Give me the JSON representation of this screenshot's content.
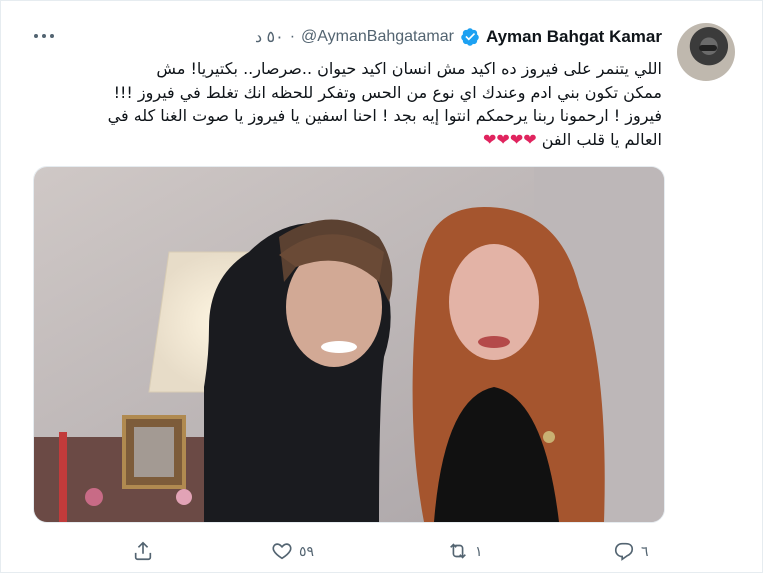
{
  "tweet": {
    "author_name": "Ayman Bahgat Kamar",
    "handle": "@AymanBahgatamar",
    "dot": "·",
    "time": "٥٠ د",
    "text_lines": [
      "اللي يتنمر على فيروز ده اكيد مش انسان اكيد حيوان ..صرصار.. بكتيريا!  مش",
      "ممكن تكون بني ادم وعندك اي نوع من الحس وتفكر للحظه انك تغلط في فيروز !!!",
      "فيروز ! ارحمونا ربنا يرحمكم انتوا إيه بجد ! احنا اسفين يا فيروز يا صوت الغنا كله في",
      "العالم يا قلب الفن"
    ],
    "hearts": "❤❤❤❤"
  },
  "actions": {
    "reply_count": "٦",
    "retweet_count": "١",
    "like_count": "٥٩"
  },
  "icons": {
    "more": "more-icon",
    "verified": "verified-badge-icon",
    "reply": "reply-icon",
    "retweet": "retweet-icon",
    "like": "like-icon",
    "share": "share-icon"
  },
  "colors": {
    "verified": "#1da1f2",
    "secondary_text": "#536471",
    "heart": "#e0245e"
  }
}
